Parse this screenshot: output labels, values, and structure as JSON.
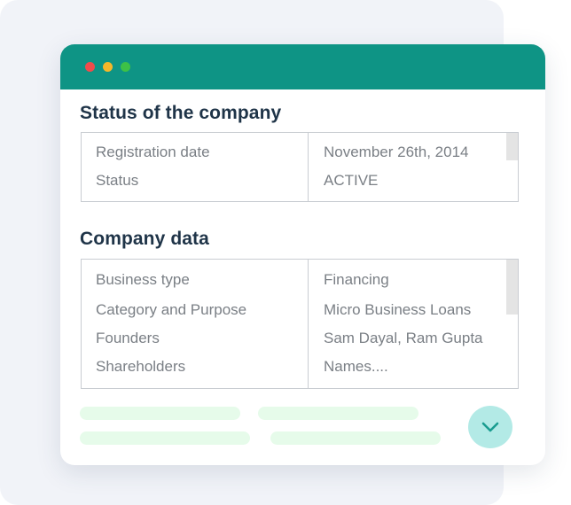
{
  "colors": {
    "titlebar": "#0e9485",
    "dot_close": "#f04b4b",
    "dot_minimize": "#f5b72a",
    "dot_maximize": "#3dc146",
    "heading": "#1f3448",
    "cell_text": "#7a7f85",
    "expand_button": "#b3eae6",
    "expand_icon": "#1a9c90",
    "placeholder": "#e6fbea"
  },
  "status_section": {
    "title": "Status of the company",
    "rows": [
      {
        "label": "Registration date",
        "value": "November 26th, 2014"
      },
      {
        "label": "Status",
        "value": "ACTIVE"
      }
    ]
  },
  "company_section": {
    "title": "Company data",
    "rows": [
      {
        "label": "Business type",
        "value": "Financing"
      },
      {
        "label": "Category and Purpose",
        "value": "Micro Business Loans"
      },
      {
        "label": "Founders",
        "value": "Sam Dayal, Ram Gupta"
      },
      {
        "label": "Shareholders",
        "value": "Names...."
      }
    ]
  },
  "icons": {
    "expand": "chevron-down-icon"
  }
}
